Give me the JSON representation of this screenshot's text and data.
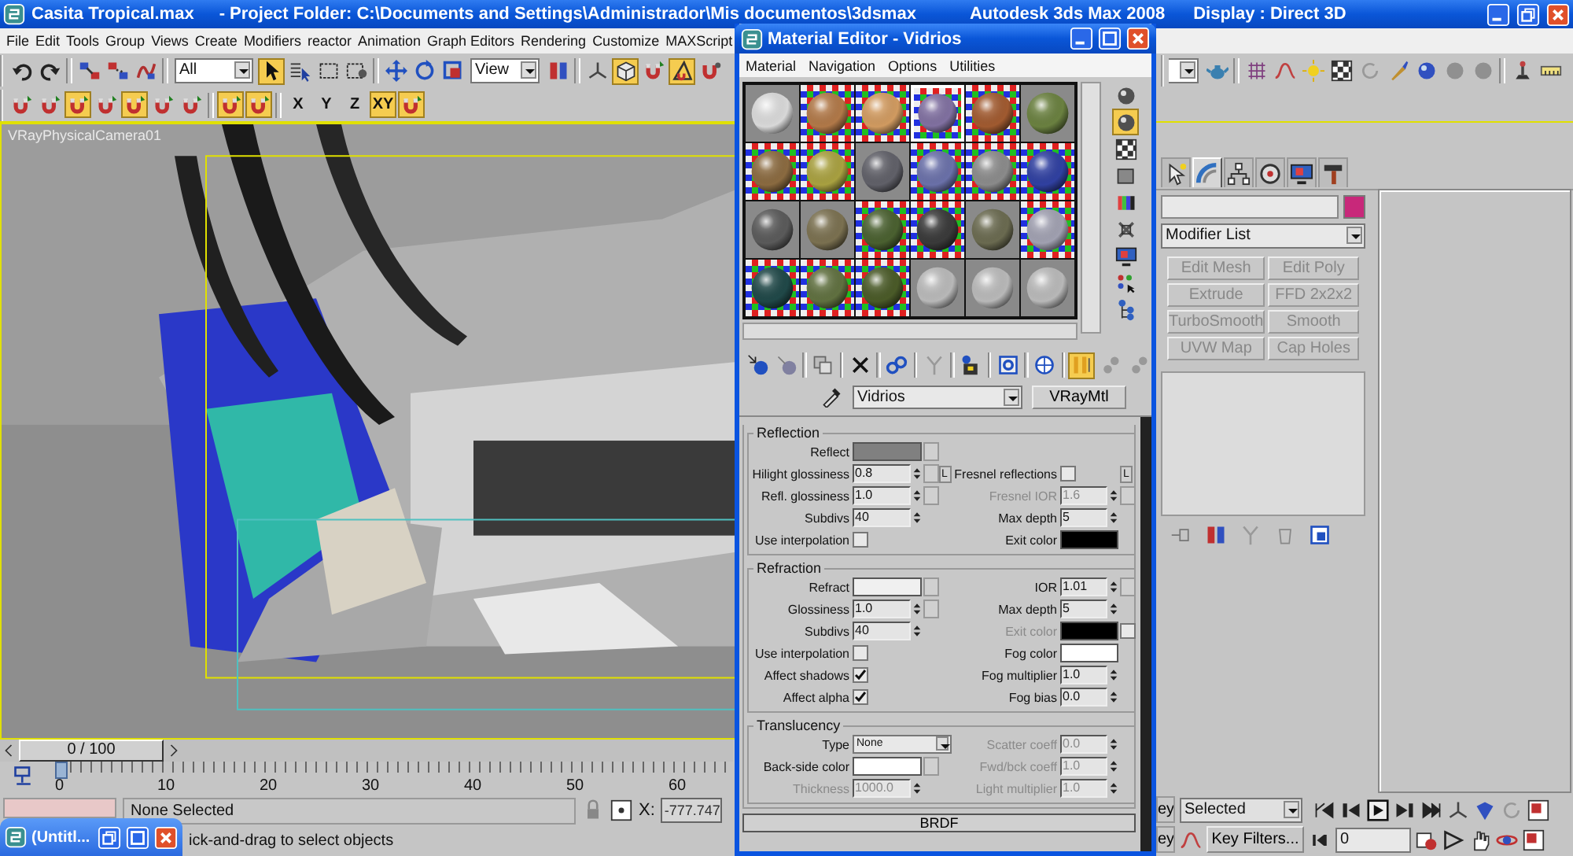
{
  "window": {
    "title": "Casita Tropical.max",
    "project": "- Project Folder: C:\\Documents and Settings\\Administrador\\Mis documentos\\3dsmax",
    "app": "Autodesk 3ds Max 2008",
    "display": "Display : Direct 3D"
  },
  "menu": [
    "File",
    "Edit",
    "Tools",
    "Group",
    "Views",
    "Create",
    "Modifiers",
    "reactor",
    "Animation",
    "Graph Editors",
    "Rendering",
    "Customize",
    "MAXScript"
  ],
  "main_toolbar": {
    "selection_filter": "All",
    "reference_coordinate": "View",
    "tools": [
      {
        "active": false
      },
      {
        "active": false
      },
      {
        "active": false
      },
      {
        "active": false
      },
      {
        "active": false
      },
      {
        "active": true
      },
      {
        "active": false
      },
      {
        "active": false
      },
      {
        "active": false
      },
      {
        "active": false
      },
      {
        "active": false
      },
      {
        "active": false
      },
      {
        "active": false
      },
      {
        "active": false
      },
      {
        "active": true
      },
      {
        "active": false
      },
      {
        "active": true
      },
      {
        "active": false
      },
      {
        "active": false
      },
      {
        "active": false
      },
      {
        "active": false
      },
      {
        "active": false
      },
      {
        "active": false
      },
      {
        "active": false
      },
      {
        "active": false
      },
      {
        "active": false
      },
      {
        "active": false
      },
      {
        "active": false
      },
      {
        "active": false
      },
      {
        "active": false
      }
    ]
  },
  "snap_toolbar": {
    "tools": [
      {
        "active": false
      },
      {
        "active": false
      },
      {
        "active": true
      },
      {
        "active": false
      },
      {
        "active": true
      },
      {
        "active": false
      },
      {
        "active": false
      },
      {
        "active": true
      },
      {
        "active": true
      },
      {
        "active": true
      }
    ],
    "axes": [
      {
        "label": "X",
        "selected": false
      },
      {
        "label": "Y",
        "selected": false
      },
      {
        "label": "Z",
        "selected": false
      },
      {
        "label": "XY",
        "selected": true
      }
    ]
  },
  "viewport": {
    "label": "VRayPhysicalCamera01"
  },
  "command_panel": {
    "tabs": [
      {
        "selected": false
      },
      {
        "selected": true
      },
      {
        "selected": false
      },
      {
        "selected": false
      },
      {
        "selected": false
      },
      {
        "selected": false
      }
    ],
    "object_swatch": {
      "color": "#c8287a"
    },
    "modifier_list": "Modifier List",
    "modifier_buttons": [
      "Edit Mesh",
      "Edit Poly",
      "Extrude",
      "FFD 2x2x2",
      "TurboSmooth",
      "Smooth",
      "UVW Map",
      "Cap Holes"
    ]
  },
  "time_slider": {
    "position": "0 / 100",
    "level": 0
  },
  "track_bar": {
    "ticks": [
      "0",
      "10",
      "20",
      "30",
      "40",
      "50",
      "60"
    ]
  },
  "status": {
    "selection": "None Selected",
    "x_label": "X:",
    "x_value": "-777.747",
    "prompt": "ick-and-drag to select objects"
  },
  "animation_controls": {
    "key_buttons": [
      "ey",
      "ey"
    ],
    "key_mode": "Selected",
    "key_filters": "Key Filters...",
    "frame": "0"
  },
  "taskbar_window": {
    "title": "(Untitl..."
  },
  "material_editor": {
    "title": "Material Editor - Vidrios",
    "menu": [
      "Material",
      "Navigation",
      "Options",
      "Utilities"
    ],
    "slots": [
      {
        "color": "#d8d8d8",
        "checker": false,
        "selected": false
      },
      {
        "color": "#b07848",
        "checker": true,
        "selected": false
      },
      {
        "color": "#d09a60",
        "checker": true,
        "selected": false
      },
      {
        "color": "#8070a0",
        "checker": true,
        "selected": true
      },
      {
        "color": "#a05a30",
        "checker": true,
        "selected": false
      },
      {
        "color": "#6a8040",
        "checker": false,
        "selected": false
      },
      {
        "color": "#8a6a40",
        "checker": true,
        "selected": false
      },
      {
        "color": "#a8a040",
        "checker": true,
        "selected": false
      },
      {
        "color": "#606068",
        "checker": false,
        "selected": false
      },
      {
        "color": "#6a70a8",
        "checker": true,
        "selected": false
      },
      {
        "color": "#8a8a8a",
        "checker": true,
        "selected": false
      },
      {
        "color": "#3040a0",
        "checker": true,
        "selected": false
      },
      {
        "color": "#5a5a5a",
        "checker": false,
        "selected": false
      },
      {
        "color": "#7a7050",
        "checker": false,
        "selected": false
      },
      {
        "color": "#4a6030",
        "checker": true,
        "selected": false
      },
      {
        "color": "#3a3a3a",
        "checker": true,
        "selected": false
      },
      {
        "color": "#6a6a50",
        "checker": false,
        "selected": false
      },
      {
        "color": "#a0a0b0",
        "checker": true,
        "selected": false
      },
      {
        "color": "#204848",
        "checker": true,
        "selected": false
      },
      {
        "color": "#607040",
        "checker": true,
        "selected": false
      },
      {
        "color": "#4a5a28",
        "checker": true,
        "selected": false
      },
      {
        "color": "#b8b8b8",
        "checker": false,
        "selected": false
      },
      {
        "color": "#b8b8b8",
        "checker": false,
        "selected": false
      },
      {
        "color": "#b8b8b8",
        "checker": false,
        "selected": false
      }
    ],
    "side_tools": [
      {
        "active": false
      },
      {
        "active": true
      },
      {
        "active": false
      },
      {
        "active": false
      },
      {
        "active": false
      },
      {
        "active": false
      },
      {
        "active": false
      },
      {
        "active": false
      },
      {
        "active": false
      }
    ],
    "bottom_tools": [
      {
        "active": false
      },
      {
        "active": false
      },
      {
        "active": false
      },
      {
        "active": false
      },
      {
        "active": false
      },
      {
        "active": false
      },
      {
        "active": false
      },
      {
        "active": false
      },
      {
        "active": false
      },
      {
        "active": true
      },
      {
        "active": false
      },
      {
        "active": false
      }
    ],
    "material_name": "Vidrios",
    "material_type": "VRayMtl",
    "groups": [
      {
        "title": "Reflection",
        "rows": [
          {
            "left": {
              "label": "Reflect",
              "kind": "color",
              "color": "#808080",
              "map": true
            }
          },
          {
            "left": {
              "label": "Hilight glossiness",
              "kind": "spinner",
              "value": "0.8",
              "map": true,
              "lock": "L"
            },
            "right": {
              "label": "Fresnel reflections",
              "kind": "checkbox",
              "checked": false,
              "lock": "L"
            }
          },
          {
            "left": {
              "label": "Refl. glossiness",
              "kind": "spinner",
              "value": "1.0",
              "map": true
            },
            "right": {
              "label": "Fresnel IOR",
              "kind": "spinner",
              "value": "1.6",
              "disabled": true,
              "map": true
            }
          },
          {
            "left": {
              "label": "Subdivs",
              "kind": "spinner",
              "value": "40"
            },
            "right": {
              "label": "Max depth",
              "kind": "spinner",
              "value": "5"
            }
          },
          {
            "left": {
              "label": "Use interpolation",
              "kind": "checkbox",
              "checked": false
            },
            "right": {
              "label": "Exit color",
              "kind": "color",
              "color": "#000000"
            }
          }
        ]
      },
      {
        "title": "Refraction",
        "rows": [
          {
            "left": {
              "label": "Refract",
              "kind": "color",
              "color": "#f0f0f0",
              "map": true
            },
            "right": {
              "label": "IOR",
              "kind": "spinner",
              "value": "1.01",
              "map": true
            }
          },
          {
            "left": {
              "label": "Glossiness",
              "kind": "spinner",
              "value": "1.0",
              "map": true
            },
            "right": {
              "label": "Max depth",
              "kind": "spinner",
              "value": "5"
            }
          },
          {
            "left": {
              "label": "Subdivs",
              "kind": "spinner",
              "value": "40"
            },
            "right": {
              "label": "Exit color",
              "kind": "color",
              "color": "#000000",
              "disabled": true,
              "toggle": false
            }
          },
          {
            "left": {
              "label": "Use interpolation",
              "kind": "checkbox",
              "checked": false
            },
            "right": {
              "label": "Fog color",
              "kind": "color",
              "color": "#ffffff"
            }
          },
          {
            "left": {
              "label": "Affect shadows",
              "kind": "checkbox",
              "checked": true
            },
            "right": {
              "label": "Fog multiplier",
              "kind": "spinner",
              "value": "1.0"
            }
          },
          {
            "left": {
              "label": "Affect alpha",
              "kind": "checkbox",
              "checked": true
            },
            "right": {
              "label": "Fog bias",
              "kind": "spinner",
              "value": "0.0"
            }
          }
        ]
      },
      {
        "title": "Translucency",
        "rows": [
          {
            "left": {
              "label": "Type",
              "kind": "dropdown",
              "value": "None"
            },
            "right": {
              "label": "Scatter coeff",
              "kind": "spinner",
              "value": "0.0",
              "disabled": true
            }
          },
          {
            "left": {
              "label": "Back-side color",
              "kind": "color",
              "color": "#ffffff",
              "map": true
            },
            "right": {
              "label": "Fwd/bck coeff",
              "kind": "spinner",
              "value": "1.0",
              "disabled": true
            }
          },
          {
            "left": {
              "label": "Thickness",
              "kind": "spinner",
              "value": "1000.0",
              "disabled": true
            },
            "right": {
              "label": "Light multiplier",
              "kind": "spinner",
              "value": "1.0",
              "disabled": true
            }
          }
        ]
      }
    ],
    "next_rollout": "BRDF"
  }
}
